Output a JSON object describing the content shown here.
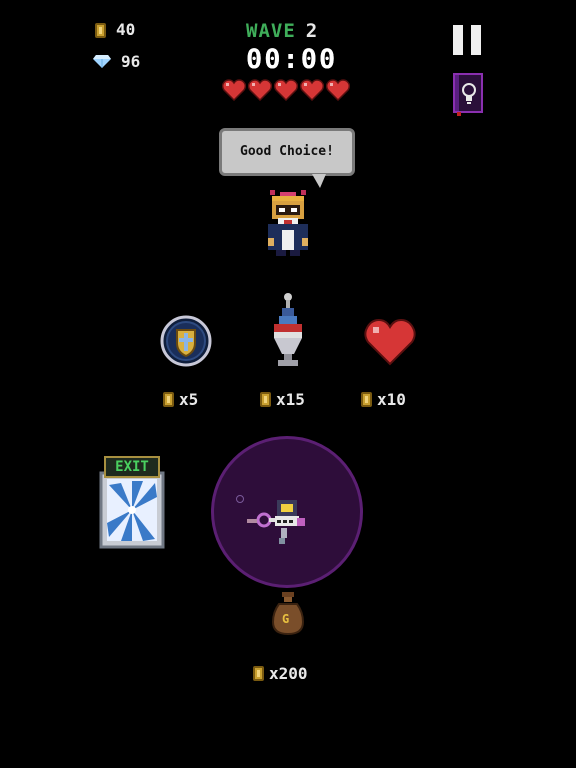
{
  "hud": {
    "coins": "40",
    "gems": "96",
    "wave_label": "WAVE",
    "wave_number": "2",
    "timer": "00:00",
    "hearts_full": 5,
    "hearts_total": 5
  },
  "icons": {
    "coin": "coin-icon",
    "gem": "gem-icon",
    "heart": "heart-icon",
    "pause": "pause-icon",
    "hint": "lightbulb-book-icon"
  },
  "speech": {
    "text": "Good Choice!"
  },
  "shop": {
    "items": [
      {
        "name": "shield",
        "price": "x5"
      },
      {
        "name": "potion",
        "price": "x15"
      },
      {
        "name": "heart",
        "price": "x10"
      }
    ]
  },
  "exit": {
    "sign": "EXIT"
  },
  "bag": {
    "label": "G",
    "price": "x200"
  },
  "colors": {
    "background": "#000000",
    "wave_label": "#3fae5a",
    "heart": "#d63636",
    "portal": "#2e0d3a",
    "portal_ring": "#5b1f73",
    "coin": "#c9a030",
    "bubble": "#c8c8c8"
  }
}
